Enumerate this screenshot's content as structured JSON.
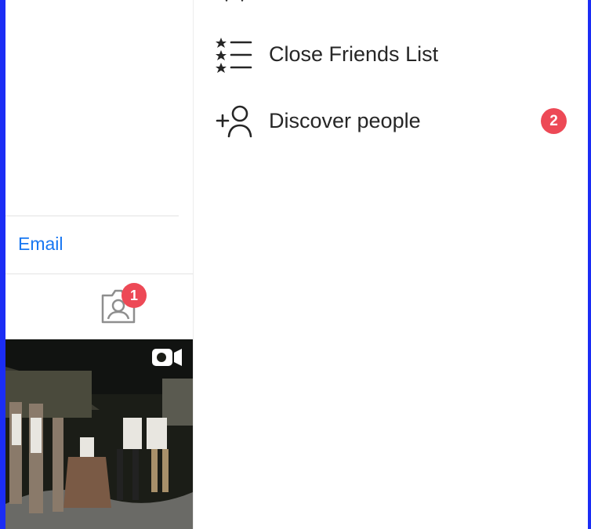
{
  "profile": {
    "email_label": "Email",
    "tagged_badge": "1"
  },
  "menu": {
    "items": [
      {
        "label": "Close Friends List",
        "icon": "star-list-icon",
        "badge": ""
      },
      {
        "label": "Discover people",
        "icon": "add-person-icon",
        "badge": "2"
      }
    ]
  },
  "colors": {
    "accent": "#1877f2",
    "badge": "#ed4956",
    "text": "#262626",
    "frame": "#1b2df5"
  }
}
